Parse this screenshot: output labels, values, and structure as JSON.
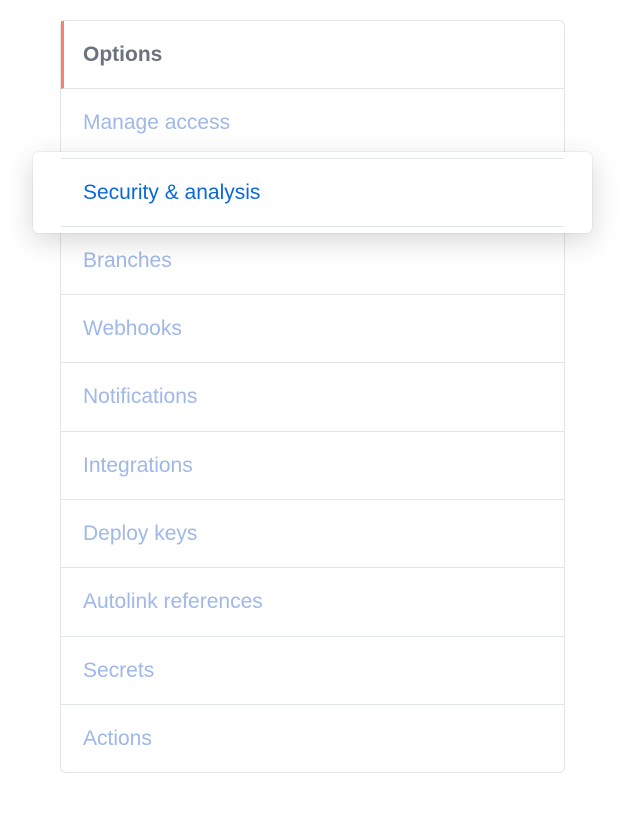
{
  "sidebar": {
    "header": "Options",
    "items": [
      {
        "label": "Manage access"
      },
      {
        "label": "Security & analysis"
      },
      {
        "label": "Branches"
      },
      {
        "label": "Webhooks"
      },
      {
        "label": "Notifications"
      },
      {
        "label": "Integrations"
      },
      {
        "label": "Deploy keys"
      },
      {
        "label": "Autolink references"
      },
      {
        "label": "Secrets"
      },
      {
        "label": "Actions"
      }
    ]
  }
}
